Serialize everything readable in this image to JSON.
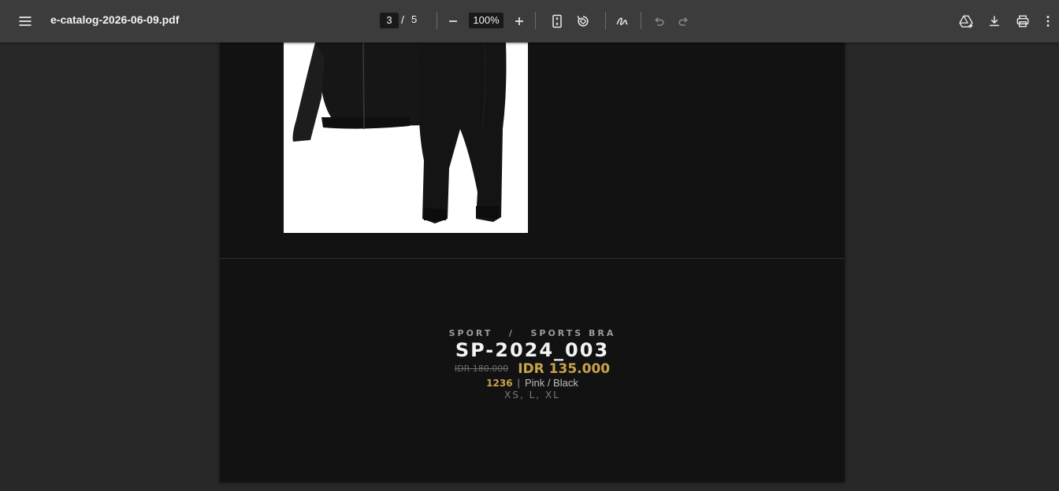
{
  "toolbar": {
    "document_title": "e-catalog-2026-06-09.pdf",
    "current_page": "3",
    "page_separator": "/",
    "total_pages": "5",
    "zoom": "100%",
    "icons": {
      "menu": "menu-icon",
      "zoom_out": "minus-icon",
      "zoom_in": "plus-icon",
      "fit_page": "fit-page-icon",
      "rotate": "rotate-icon",
      "annotate": "pen-icon",
      "undo": "undo-icon",
      "redo": "redo-icon",
      "drive": "drive-icon",
      "download": "download-icon",
      "print": "print-icon",
      "more": "more-vert-icon"
    }
  },
  "page": {
    "product": {
      "breadcrumb_category": "SPORT",
      "breadcrumb_separator": "/",
      "breadcrumb_subcategory": "SPORTS BRA",
      "sku": "SP-2024_003",
      "original_price": "IDR 180.000",
      "sale_price": "IDR 135.000",
      "stock": "1236",
      "separator": "|",
      "colors": "Pink / Black",
      "sizes": "XS, L, XL"
    }
  },
  "colors": {
    "toolbar_bg": "#3c3c3c",
    "viewer_bg": "#282828",
    "page_bg": "#121212",
    "accent_gold": "#c9a24b"
  }
}
